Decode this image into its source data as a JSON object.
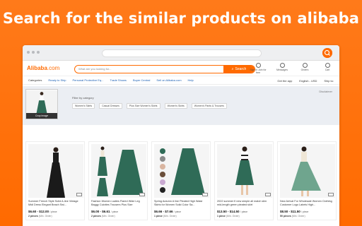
{
  "headline": "Search for the similar products on alibaba",
  "site": {
    "logo_brand": "Alibaba",
    "logo_suffix": ".com",
    "search_placeholder": "What are you looking for...",
    "search_button": "Search",
    "tools": [
      {
        "label": "Sign in\nJoin for free"
      },
      {
        "label": "Messages"
      },
      {
        "label": "Orders"
      },
      {
        "label": "Cart"
      }
    ]
  },
  "nav": {
    "items": [
      {
        "label": "Categories",
        "blue": false
      },
      {
        "label": "Ready to Ship",
        "blue": true
      },
      {
        "label": "Personal Protective Eq...",
        "blue": true
      },
      {
        "label": "Trade Shows",
        "blue": true
      },
      {
        "label": "Buyer Central",
        "blue": true
      },
      {
        "label": "Sell on Alibaba.com",
        "blue": true
      },
      {
        "label": "Help",
        "blue": true
      }
    ],
    "right": [
      "Get the app",
      "English - USD",
      "Ship to:"
    ]
  },
  "filter": {
    "crop_label": "Crop image",
    "label": "Filter by category",
    "chips": [
      "Women's Skirts",
      "Casual Dresses",
      "Plus Size Women's Skirts",
      "Women's Skirts",
      "Women's Pants & Trousers"
    ],
    "disclaimer": "Disclaimer"
  },
  "products": [
    {
      "title": "Summer French Style Solid A-line Vintage Midi Dress Elegant Beach Swi...",
      "price": "$6.60 - $12.00",
      "unit": "/ piece",
      "moq": "2 pieces",
      "moq_suffix": "(Min. Order)"
    },
    {
      "title": "Fashion Women Ladies Flared Wide Leg Baggy Culottes Trousers Plus Size",
      "price": "$6.00 - $6.61",
      "unit": "/ piece",
      "moq": "2 pieces",
      "moq_suffix": "(Min. Order)"
    },
    {
      "title": "Spring Autumn A line Pleated High Waist Skirts for Women Solid Color Sa...",
      "price": "$6.66 - $7.66",
      "unit": "/ piece",
      "moq": "1 piece",
      "moq_suffix": "(Min. Order)"
    },
    {
      "title": "2022 summer fi new simple all match slim mid-length green pleated skirt",
      "price": "$13.50 - $14.50",
      "unit": "/ piece",
      "moq": "1 piece",
      "moq_suffix": "(Min. Order)"
    },
    {
      "title": "New Arrival For Wholesale Women Clothing Customer Logo Labels High...",
      "price": "$8.50 - $11.50",
      "unit": "/ piece",
      "moq": "50 pieces",
      "moq_suffix": "(Min. Order)"
    }
  ],
  "colors": {
    "brand": "#ff6a00",
    "skirt": "#2f6b57",
    "panel": "#ebeef3"
  }
}
